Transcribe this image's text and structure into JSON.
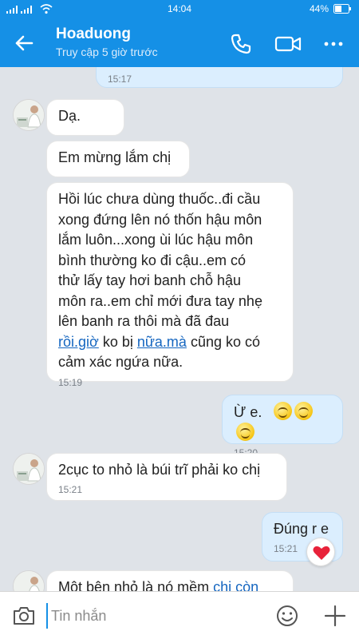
{
  "status_bar": {
    "time": "14:04",
    "battery": "44%"
  },
  "header": {
    "contact_name": "Hoaduong",
    "last_seen": "Truy cập 5 giờ trước"
  },
  "messages": {
    "m0": {
      "time": "15:17"
    },
    "m1": {
      "text": "Dạ."
    },
    "m2": {
      "text": "Em mừng lắm chị"
    },
    "m3": {
      "lines": [
        "Hồi lúc chưa dùng thuốc..đi cầu",
        "xong đứng lên nó thốn hậu môn",
        "lắm luôn...xong ùi lúc hậu môn",
        "bình thường ko đi cậu..em có",
        "thử lấy tay hơi banh chỗ hậu",
        "môn ra..em chỉ mới đưa tay nhẹ",
        "lên banh ra thôi mà đã đau"
      ],
      "link1": "rồi.giờ",
      "mid": " ko bị ",
      "link2": "nữa.mà",
      "end": " cũng ko có",
      "last_line": "cảm xác ngứa nữa.",
      "time": "15:19"
    },
    "m4": {
      "text": "Ừ e.",
      "time": "15:20"
    },
    "m5": {
      "text": "2cục to nhỏ là búi trĩ phải ko chị",
      "time": "15:21"
    },
    "m6": {
      "text": "Đúng r e",
      "time": "15:21"
    },
    "m7": {
      "text": "Một bên nhỏ là nó mềm ",
      "link": "chị còn"
    }
  },
  "composer": {
    "placeholder": "Tin nhắn"
  },
  "colors": {
    "primary": "#1590e6",
    "incoming_bubble": "#ffffff",
    "outgoing_bubble": "#dbeefe",
    "heart": "#e8223a"
  },
  "icons": [
    "back-arrow-icon",
    "phone-icon",
    "video-call-icon",
    "more-icon",
    "camera-icon",
    "emoji-icon",
    "plus-icon",
    "heart-icon",
    "smiley-emoji-icon"
  ]
}
